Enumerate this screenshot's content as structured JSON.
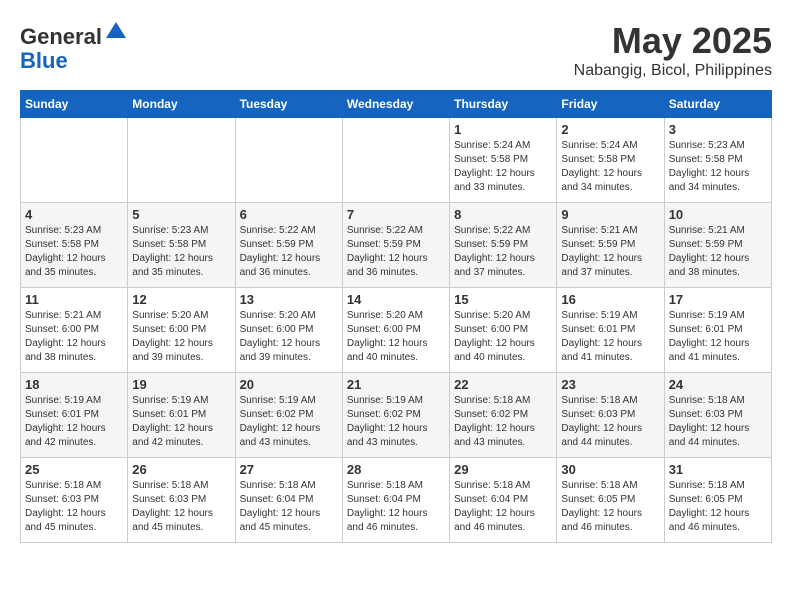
{
  "logo": {
    "general": "General",
    "blue": "Blue"
  },
  "title": "May 2025",
  "subtitle": "Nabangig, Bicol, Philippines",
  "headers": [
    "Sunday",
    "Monday",
    "Tuesday",
    "Wednesday",
    "Thursday",
    "Friday",
    "Saturday"
  ],
  "weeks": [
    [
      {
        "day": "",
        "info": ""
      },
      {
        "day": "",
        "info": ""
      },
      {
        "day": "",
        "info": ""
      },
      {
        "day": "",
        "info": ""
      },
      {
        "day": "1",
        "info": "Sunrise: 5:24 AM\nSunset: 5:58 PM\nDaylight: 12 hours\nand 33 minutes."
      },
      {
        "day": "2",
        "info": "Sunrise: 5:24 AM\nSunset: 5:58 PM\nDaylight: 12 hours\nand 34 minutes."
      },
      {
        "day": "3",
        "info": "Sunrise: 5:23 AM\nSunset: 5:58 PM\nDaylight: 12 hours\nand 34 minutes."
      }
    ],
    [
      {
        "day": "4",
        "info": "Sunrise: 5:23 AM\nSunset: 5:58 PM\nDaylight: 12 hours\nand 35 minutes."
      },
      {
        "day": "5",
        "info": "Sunrise: 5:23 AM\nSunset: 5:58 PM\nDaylight: 12 hours\nand 35 minutes."
      },
      {
        "day": "6",
        "info": "Sunrise: 5:22 AM\nSunset: 5:59 PM\nDaylight: 12 hours\nand 36 minutes."
      },
      {
        "day": "7",
        "info": "Sunrise: 5:22 AM\nSunset: 5:59 PM\nDaylight: 12 hours\nand 36 minutes."
      },
      {
        "day": "8",
        "info": "Sunrise: 5:22 AM\nSunset: 5:59 PM\nDaylight: 12 hours\nand 37 minutes."
      },
      {
        "day": "9",
        "info": "Sunrise: 5:21 AM\nSunset: 5:59 PM\nDaylight: 12 hours\nand 37 minutes."
      },
      {
        "day": "10",
        "info": "Sunrise: 5:21 AM\nSunset: 5:59 PM\nDaylight: 12 hours\nand 38 minutes."
      }
    ],
    [
      {
        "day": "11",
        "info": "Sunrise: 5:21 AM\nSunset: 6:00 PM\nDaylight: 12 hours\nand 38 minutes."
      },
      {
        "day": "12",
        "info": "Sunrise: 5:20 AM\nSunset: 6:00 PM\nDaylight: 12 hours\nand 39 minutes."
      },
      {
        "day": "13",
        "info": "Sunrise: 5:20 AM\nSunset: 6:00 PM\nDaylight: 12 hours\nand 39 minutes."
      },
      {
        "day": "14",
        "info": "Sunrise: 5:20 AM\nSunset: 6:00 PM\nDaylight: 12 hours\nand 40 minutes."
      },
      {
        "day": "15",
        "info": "Sunrise: 5:20 AM\nSunset: 6:00 PM\nDaylight: 12 hours\nand 40 minutes."
      },
      {
        "day": "16",
        "info": "Sunrise: 5:19 AM\nSunset: 6:01 PM\nDaylight: 12 hours\nand 41 minutes."
      },
      {
        "day": "17",
        "info": "Sunrise: 5:19 AM\nSunset: 6:01 PM\nDaylight: 12 hours\nand 41 minutes."
      }
    ],
    [
      {
        "day": "18",
        "info": "Sunrise: 5:19 AM\nSunset: 6:01 PM\nDaylight: 12 hours\nand 42 minutes."
      },
      {
        "day": "19",
        "info": "Sunrise: 5:19 AM\nSunset: 6:01 PM\nDaylight: 12 hours\nand 42 minutes."
      },
      {
        "day": "20",
        "info": "Sunrise: 5:19 AM\nSunset: 6:02 PM\nDaylight: 12 hours\nand 43 minutes."
      },
      {
        "day": "21",
        "info": "Sunrise: 5:19 AM\nSunset: 6:02 PM\nDaylight: 12 hours\nand 43 minutes."
      },
      {
        "day": "22",
        "info": "Sunrise: 5:18 AM\nSunset: 6:02 PM\nDaylight: 12 hours\nand 43 minutes."
      },
      {
        "day": "23",
        "info": "Sunrise: 5:18 AM\nSunset: 6:03 PM\nDaylight: 12 hours\nand 44 minutes."
      },
      {
        "day": "24",
        "info": "Sunrise: 5:18 AM\nSunset: 6:03 PM\nDaylight: 12 hours\nand 44 minutes."
      }
    ],
    [
      {
        "day": "25",
        "info": "Sunrise: 5:18 AM\nSunset: 6:03 PM\nDaylight: 12 hours\nand 45 minutes."
      },
      {
        "day": "26",
        "info": "Sunrise: 5:18 AM\nSunset: 6:03 PM\nDaylight: 12 hours\nand 45 minutes."
      },
      {
        "day": "27",
        "info": "Sunrise: 5:18 AM\nSunset: 6:04 PM\nDaylight: 12 hours\nand 45 minutes."
      },
      {
        "day": "28",
        "info": "Sunrise: 5:18 AM\nSunset: 6:04 PM\nDaylight: 12 hours\nand 46 minutes."
      },
      {
        "day": "29",
        "info": "Sunrise: 5:18 AM\nSunset: 6:04 PM\nDaylight: 12 hours\nand 46 minutes."
      },
      {
        "day": "30",
        "info": "Sunrise: 5:18 AM\nSunset: 6:05 PM\nDaylight: 12 hours\nand 46 minutes."
      },
      {
        "day": "31",
        "info": "Sunrise: 5:18 AM\nSunset: 6:05 PM\nDaylight: 12 hours\nand 46 minutes."
      }
    ]
  ]
}
